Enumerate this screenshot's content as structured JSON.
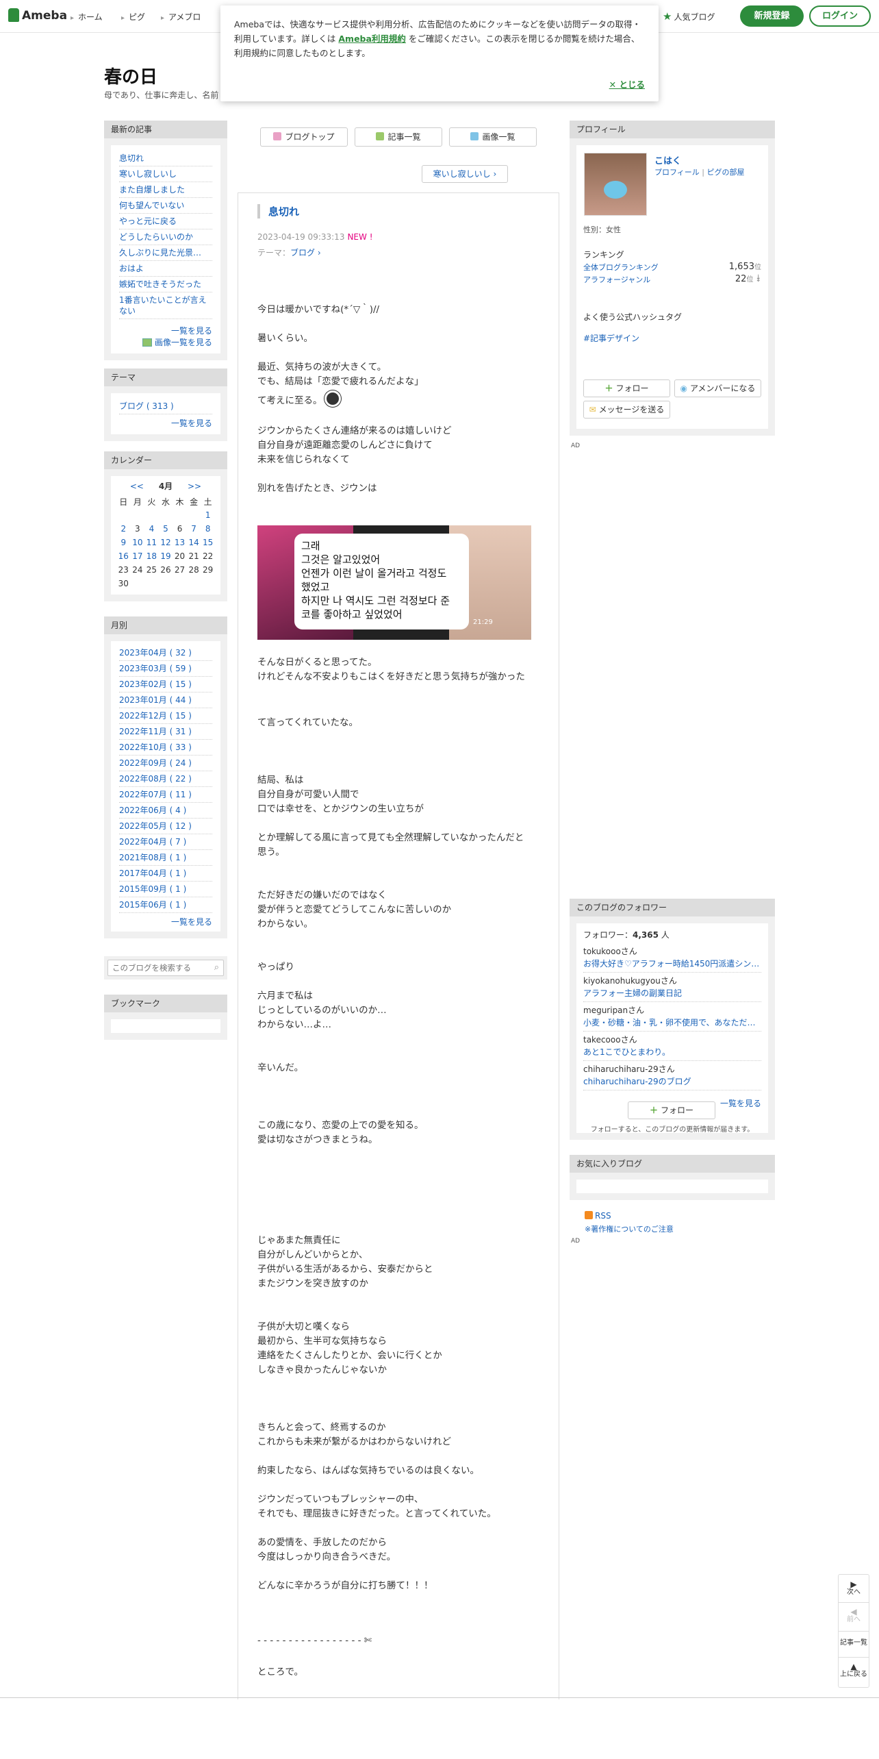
{
  "header": {
    "logo": "Ameba",
    "nav": [
      "ホーム",
      "ピグ",
      "アメブロ"
    ],
    "popular": "人気ブログ",
    "register": "新規登録",
    "login": "ログイン"
  },
  "cookie": {
    "text_before": "Amebaでは、快適なサービス提供や利用分析、広告配信のためにクッキーなどを使い訪問データの取得・利用しています。詳しくは",
    "link": "Ameba利用規約",
    "text_after": "をご確認ください。この表示を閉じるか閲覧を続けた場合、利用規約に同意したものとします。",
    "close": "✕ とじる"
  },
  "blog": {
    "title": "春の日",
    "subtitle": "母であり、仕事に奔走し、名前"
  },
  "left": {
    "recent_title": "最新の記事",
    "recent": [
      "息切れ",
      "寒いし寂しいし",
      "また自爆しました",
      "何も望んでいない",
      "やっと元に戻る",
      "どうしたらいいのか",
      "久しぶりに見た光景…",
      "おはよ",
      "嫉妬で吐きそうだった",
      "1番言いたいことが言えない"
    ],
    "recent_more": "一覧を見る",
    "image_more": "画像一覧を見る",
    "theme_title": "テーマ",
    "theme_item": "ブログ ( 313 )",
    "theme_more": "一覧を見る",
    "cal_title": "カレンダー",
    "cal_prev": "<<",
    "cal_month": "4月",
    "cal_next": ">>",
    "cal_head": [
      "日",
      "月",
      "火",
      "水",
      "木",
      "金",
      "土"
    ],
    "cal_rows": [
      [
        "",
        "",
        "",
        "",
        "",
        "",
        "1"
      ],
      [
        "2",
        "3",
        "4",
        "5",
        "6",
        "7",
        "8"
      ],
      [
        "9",
        "10",
        "11",
        "12",
        "13",
        "14",
        "15"
      ],
      [
        "16",
        "17",
        "18",
        "19",
        "20",
        "21",
        "22"
      ],
      [
        "23",
        "24",
        "25",
        "26",
        "27",
        "28",
        "29"
      ],
      [
        "30",
        "",
        "",
        "",
        "",
        "",
        ""
      ]
    ],
    "month_title": "月別",
    "months": [
      "2023年04月 ( 32 )",
      "2023年03月 ( 59 )",
      "2023年02月 ( 15 )",
      "2023年01月 ( 44 )",
      "2022年12月 ( 15 )",
      "2022年11月 ( 31 )",
      "2022年10月 ( 33 )",
      "2022年09月 ( 24 )",
      "2022年08月 ( 22 )",
      "2022年07月 ( 11 )",
      "2022年06月 ( 4 )",
      "2022年05月 ( 12 )",
      "2022年04月 ( 7 )",
      "2021年08月 ( 1 )",
      "2017年04月 ( 1 )",
      "2015年09月 ( 1 )",
      "2015年06月 ( 1 )"
    ],
    "month_more": "一覧を見る",
    "search_placeholder": "このブログを検索する",
    "bookmark_title": "ブックマーク"
  },
  "center": {
    "btn_top": "ブログトップ",
    "btn_list": "記事一覧",
    "btn_images": "画像一覧",
    "next": "寒いし寂しいし",
    "title": "息切れ",
    "date": "2023-04-19 09:33:13",
    "new": "NEW !",
    "theme_label": "テーマ：",
    "theme": "ブログ",
    "lines": [
      "今日は暖かいですね(*´▽｀)//",
      "暑いくらい。",
      "最近、気持ちの波が大きくて。",
      "でも、結局は「恋愛で疲れるんだよな」",
      "て考えに至る。",
      "ジウンからたくさん連絡が来るのは嬉しいけど",
      "自分自身が遠距離恋愛のしんどさに負けて",
      "未来を信じられなくて",
      "別れを告げたとき、ジウンは",
      "そんな日がくると思ってた。",
      "けれどそんな不安よりもこはくを好きだと思う気持ちが強かった",
      "て言ってくれていたな。",
      "結局、私は",
      "自分自身が可愛い人間で",
      "口では幸せを、とかジウンの生い立ちが",
      "とか理解してる風に言って見ても全然理解していなかったんだと",
      "思う。",
      "ただ好きだの嫌いだのではなく",
      "愛が伴うと恋愛てどうしてこんなに苦しいのか",
      "わからない。",
      "やっぱり",
      "六月まで私は",
      "じっとしているのがいいのか…",
      "わからない…よ…",
      "辛いんだ。",
      "この歳になり、恋愛の上での愛を知る。",
      "愛は切なさがつきまとうね。",
      "じゃあまた無責任に",
      "自分がしんどいからとか、",
      "子供がいる生活があるから、安泰だからと",
      "またジウンを突き放すのか",
      "子供が大切と嘆くなら",
      "最初から、生半可な気持ちなら",
      "連絡をたくさんしたりとか、会いに行くとか",
      "しなきゃ良かったんじゃないか",
      "きちんと会って、終焉するのか",
      "これからも未来が繋がるかはわからないけれど",
      "約束したなら、はんぱな気持ちでいるのは良くない。",
      "ジウンだっていつもプレッシャーの中、",
      "それでも、理屈抜きに好きだった。と言ってくれていた。",
      "あの愛情を、手放したのだから",
      "今度はしっかり向き合うべきだ。",
      "どんなに辛かろうが自分に打ち勝て！！！",
      "- - - - - - - - - - - - - - - - - ✄",
      "ところで。"
    ],
    "photo_text": [
      "그래",
      "그것은 알고있었어",
      "언젠가 이런 날이 올거라고 걱정도",
      "했었고",
      "하지만 나 역시도 그런 걱정보다 준",
      "코를 좋아하고 싶었었어"
    ],
    "photo_time": "21:29"
  },
  "right": {
    "profile_title": "プロフィール",
    "name": "こはく",
    "profile_link": "プロフィール",
    "pig_link": "ピグの部屋",
    "gender": "性別：女性",
    "ranking": "ランキング",
    "rank1_label": "全体ブログランキング",
    "rank1_value": "1,653",
    "rank2_label": "アラフォージャンル",
    "rank2_value": "22",
    "rank_unit": "位 ↓",
    "hashtag_title": "よく使う公式ハッシュタグ",
    "hashtag": "#記事デザイン",
    "follow": "フォロー",
    "member": "アメンバーになる",
    "message": "メッセージを送る",
    "ad": "AD",
    "followers_title": "このブログのフォロワー",
    "followers_label": "フォロワー：",
    "followers_count": "4,365",
    "followers_unit": " 人",
    "followers": [
      {
        "name": "tokukoooさん",
        "blog": "お得大好き♡アラフォー時給1450円派遣シン…"
      },
      {
        "name": "kiyokanohukugyouさん",
        "blog": "アラフォー主婦の副業日記"
      },
      {
        "name": "meguripanさん",
        "blog": "小麦・砂糖・油・乳・卵不使用で、あなただ…"
      },
      {
        "name": "takecoooさん",
        "blog": "あと1こでひとまわり。"
      },
      {
        "name": "chiharuchiharu-29さん",
        "blog": "chiharuchiharu-29のブログ"
      }
    ],
    "followers_more": "一覧を見る",
    "follow2": "フォロー",
    "follow_note": "フォローすると、このブログの更新情報が届きます。",
    "fav_title": "お気に入りブログ",
    "rss": "RSS",
    "copyright": "※著作権についてのご注意",
    "ad2": "AD"
  },
  "floatnav": {
    "next": "次へ",
    "prev": "前へ",
    "list": "記事一覧",
    "top": "上に戻る"
  }
}
